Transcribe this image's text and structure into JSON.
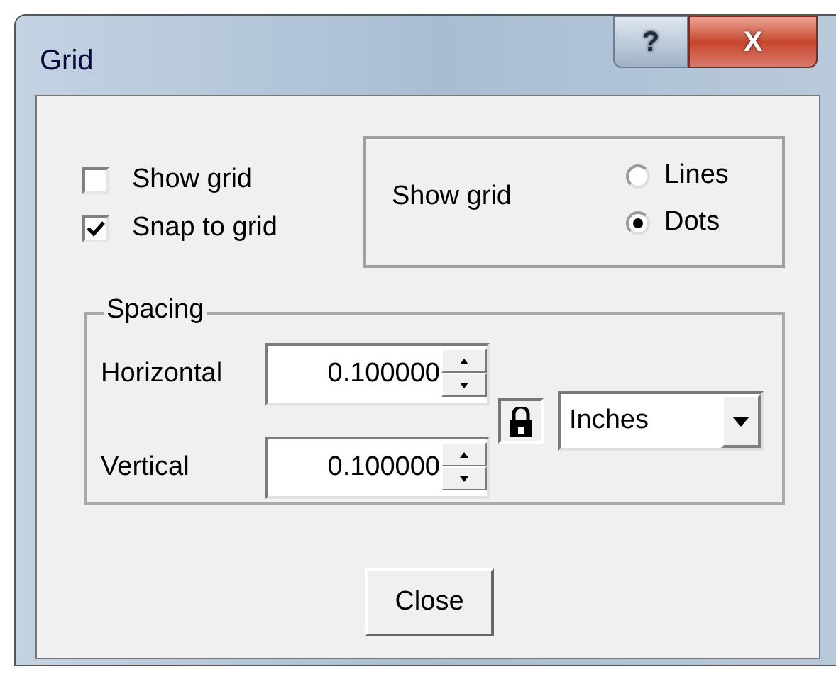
{
  "window": {
    "title": "Grid",
    "title_buttons": [
      "?",
      "X"
    ]
  },
  "checkboxes": [
    {
      "label": "Show grid",
      "checked": false
    },
    {
      "label": "Snap to grid",
      "checked": true
    }
  ],
  "grid_style": {
    "label": "Show grid",
    "options": [
      {
        "label": "Lines",
        "selected": false
      },
      {
        "label": "Dots",
        "selected": true
      }
    ]
  },
  "spacing": {
    "title": "Spacing",
    "fields": [
      {
        "label": "Horizontal",
        "value": "0.100000"
      },
      {
        "label": "Vertical",
        "value": "0.100000"
      }
    ],
    "locked": true,
    "units": "Inches"
  },
  "buttons": [
    "Close"
  ]
}
